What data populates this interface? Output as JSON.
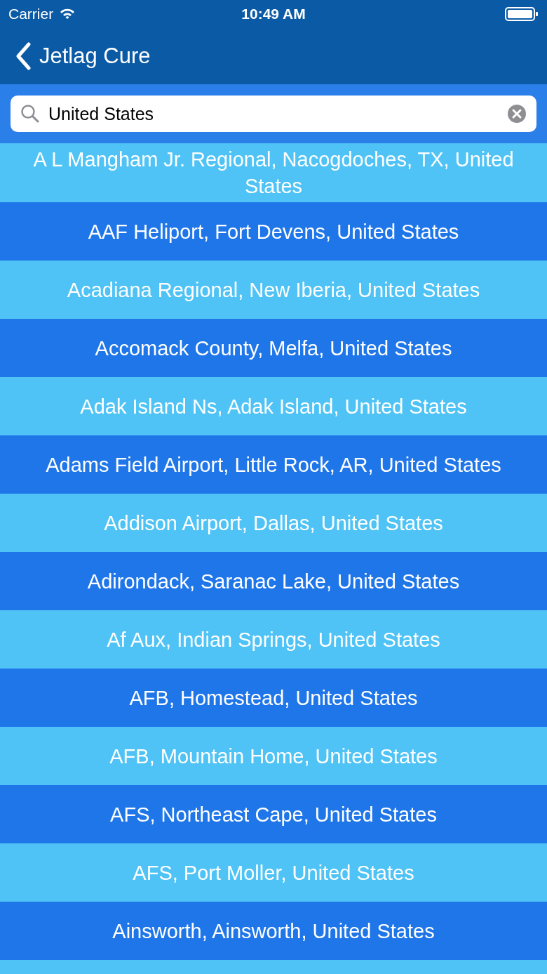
{
  "status_bar": {
    "carrier": "Carrier",
    "time": "10:49 AM"
  },
  "nav": {
    "back_label": "Jetlag Cure"
  },
  "search": {
    "value": "United States"
  },
  "results": [
    "A L Mangham Jr. Regional, Nacogdoches, TX, United States",
    "AAF Heliport, Fort Devens, United States",
    "Acadiana Regional, New Iberia, United States",
    "Accomack County, Melfa, United States",
    "Adak Island Ns, Adak Island, United States",
    "Adams Field Airport, Little Rock, AR, United States",
    "Addison Airport, Dallas, United States",
    "Adirondack, Saranac Lake, United States",
    "Af Aux, Indian Springs, United States",
    "AFB, Homestead, United States",
    "AFB, Mountain Home, United States",
    "AFS, Northeast Cape, United States",
    "AFS, Port Moller, United States",
    "Ainsworth, Ainsworth, United States"
  ]
}
